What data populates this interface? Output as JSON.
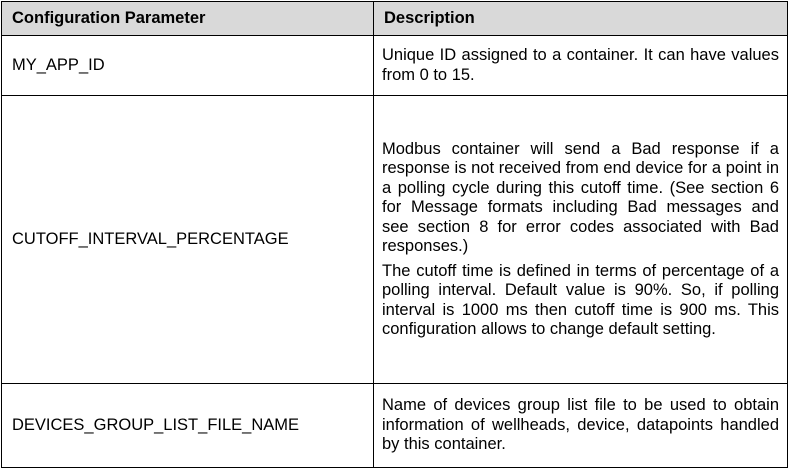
{
  "table": {
    "headers": {
      "parameter": "Configuration Parameter",
      "description": "Description"
    },
    "rows": [
      {
        "parameter": "MY_APP_ID",
        "description": [
          "Unique ID assigned to a container. It can have values from 0 to 15."
        ]
      },
      {
        "parameter": "CUTOFF_INTERVAL_PERCENTAGE",
        "description": [
          "Modbus container will send a Bad response if a response is not received from end device for a point in a polling cycle during this cutoff time. (See section 6 for Message formats including Bad messages and see section 8 for error codes associated with Bad responses.)",
          "The cutoff time is defined in terms of percentage of a polling interval. Default value is 90%. So, if polling interval is 1000 ms then cutoff time is 900 ms. This configuration allows to change default setting."
        ]
      },
      {
        "parameter": "DEVICES_GROUP_LIST_FILE_NAME",
        "description": [
          "Name of devices group list file to be used to obtain information of wellheads, device, datapoints handled by this container."
        ]
      }
    ]
  },
  "colors": {
    "header_background": "#d9d9d9",
    "border": "#000000",
    "text": "#000000",
    "page_background": "#ffffff"
  }
}
